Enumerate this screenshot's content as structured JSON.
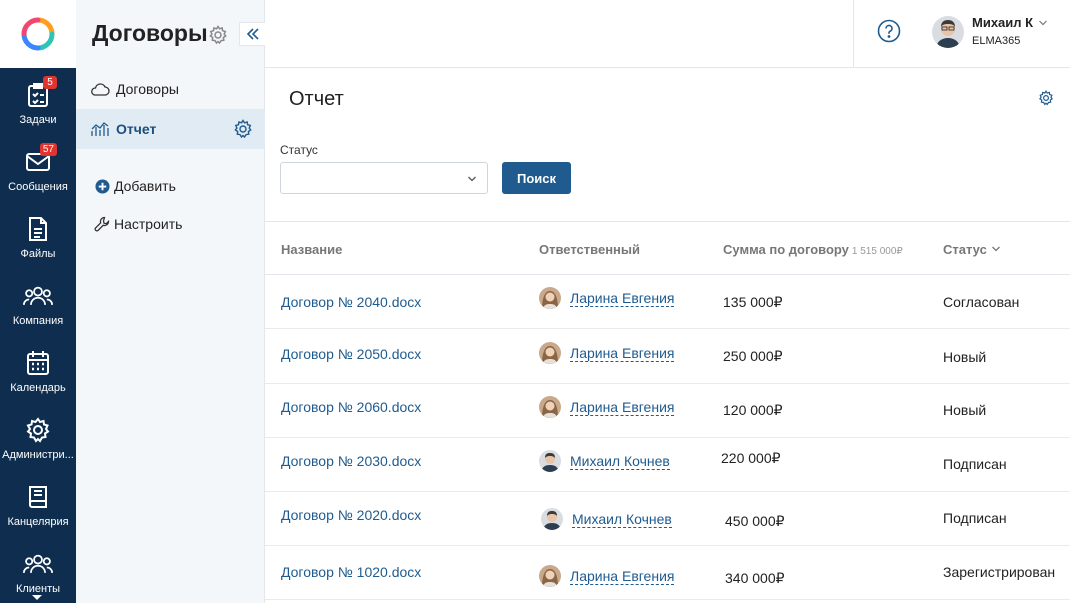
{
  "rail": {
    "items": [
      {
        "label": "Задачи",
        "badge": "5",
        "icon": "tasks-icon"
      },
      {
        "label": "Сообщения",
        "badge": "57",
        "icon": "messages-icon"
      },
      {
        "label": "Файлы",
        "badge": "",
        "icon": "files-icon"
      },
      {
        "label": "Компания",
        "badge": "",
        "icon": "company-icon"
      },
      {
        "label": "Календарь",
        "badge": "",
        "icon": "calendar-icon"
      },
      {
        "label": "Администри...",
        "badge": "",
        "icon": "admin-gear-icon"
      },
      {
        "label": "Канцелярия",
        "badge": "",
        "icon": "office-book-icon"
      },
      {
        "label": "Клиенты",
        "badge": "",
        "icon": "clients-icon"
      }
    ]
  },
  "sidebar": {
    "title": "Договоры",
    "nav": [
      {
        "label": "Договоры",
        "icon": "cloud-icon"
      },
      {
        "label": "Отчет",
        "icon": "report-chart-icon"
      }
    ],
    "actions": {
      "add": "Добавить",
      "configure": "Настроить"
    }
  },
  "header": {
    "user_name": "Михаил К",
    "org": "ELMA365"
  },
  "page": {
    "title": "Отчет",
    "filter_label": "Статус",
    "filter_value": "",
    "search_button": "Поиск"
  },
  "table": {
    "columns": {
      "name": "Название",
      "owner": "Ответственный",
      "sum": "Сумма по договору",
      "sum_total": "1 515 000₽",
      "status": "Статус"
    },
    "rows": [
      {
        "name": "Договор № 2040.docx",
        "owner": "Ларина Евгения",
        "sum": "135 000₽",
        "status": "Согласован"
      },
      {
        "name": "Договор № 2050.docx",
        "owner": "Ларина Евгения",
        "sum": "250 000₽",
        "status": "Новый"
      },
      {
        "name": "Договор № 2060.docx",
        "owner": "Ларина Евгения",
        "sum": "120 000₽",
        "status": "Новый"
      },
      {
        "name": "Договор № 2030.docx",
        "owner": "Михаил Кочнев",
        "sum": "220 000₽",
        "status": "Подписан"
      },
      {
        "name": "Договор № 2020.docx",
        "owner": "Михаил Кочнев",
        "sum": "450 000₽",
        "status": "Подписан"
      },
      {
        "name": "Договор № 1020.docx",
        "owner": "Ларина Евгения",
        "sum": "340 000₽",
        "status": "Зарегистрирован"
      }
    ]
  },
  "colors": {
    "rail_bg": "#0f2e4f",
    "accent": "#1f5b8f",
    "badge": "#e2342f",
    "active_nav_bg": "#e1ebf3"
  }
}
